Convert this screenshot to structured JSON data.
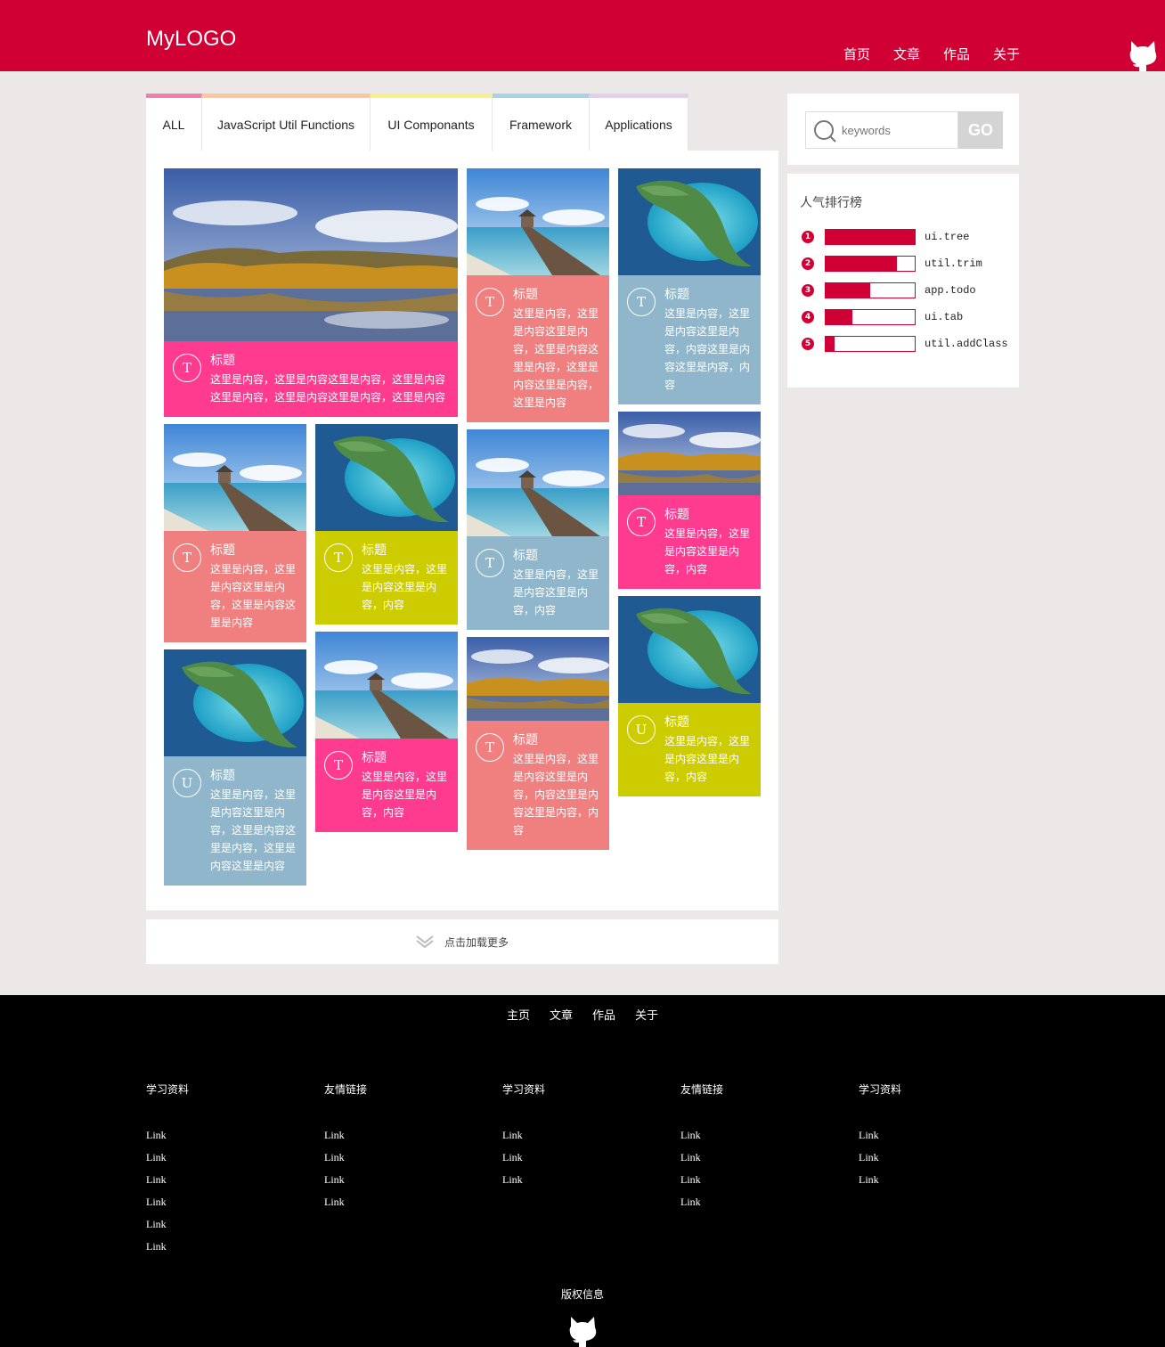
{
  "header": {
    "logo": "MyLOGO",
    "nav": [
      "首页",
      "文章",
      "作品",
      "关于"
    ]
  },
  "tabs": [
    {
      "label": "ALL",
      "color": "#f27fa9"
    },
    {
      "label": "JavaScript Util Functions",
      "color": "#f9c79b"
    },
    {
      "label": "UI Componants",
      "color": "#f7ef8a"
    },
    {
      "label": "Framework",
      "color": "#a7d3ea"
    },
    {
      "label": "Applications",
      "color": "#e4cfe8"
    }
  ],
  "cards": [
    {
      "badge": "T",
      "title": "标题",
      "text": "这里是内容，这里是内容这里是内容，这里是内容这里是内容，这里是内容这里是内容，这里是内容",
      "color": "#fe3b8f",
      "image": "lake"
    },
    {
      "badge": "T",
      "title": "标题",
      "text": "这里是内容，这里是内容这里是内容，这里是内容这里是内容，这里是内容这里是内容，这里是内容",
      "color": "#f08080",
      "image": "pier"
    },
    {
      "badge": "T",
      "title": "标题",
      "text": "这里是内容，这里是内容这里是内容，内容这里是内容这里是内容，内容",
      "color": "#8fb6cb",
      "image": "island"
    },
    {
      "badge": "T",
      "title": "标题",
      "text": "这里是内容，这里是内容这里是内容，这里是内容这里是内容",
      "color": "#f08080",
      "image": "pier"
    },
    {
      "badge": "T",
      "title": "标题",
      "text": "这里是内容，这里是内容这里是内容，内容",
      "color": "#cccc00",
      "image": "island"
    },
    {
      "badge": "T",
      "title": "标题",
      "text": "这里是内容，这里是内容这里是内容，内容",
      "color": "#8fb6cb",
      "image": "pier"
    },
    {
      "badge": "T",
      "title": "标题",
      "text": "这里是内容，这里是内容这里是内容，内容",
      "color": "#fe3b8f",
      "image": "lake"
    },
    {
      "badge": "U",
      "title": "标题",
      "text": "这里是内容，这里是内容这里是内容，这里是内容这里是内容，这里是内容这里是内容",
      "color": "#8fb6cb",
      "image": "island"
    },
    {
      "badge": "T",
      "title": "标题",
      "text": "这里是内容，这里是内容这里是内容，内容",
      "color": "#fe3b8f",
      "image": "pier"
    },
    {
      "badge": "T",
      "title": "标题",
      "text": "这里是内容，这里是内容这里是内容，内容这里是内容这里是内容，内容",
      "color": "#f08080",
      "image": "lake"
    },
    {
      "badge": "U",
      "title": "标题",
      "text": "这里是内容，这里是内容这里是内容，内容",
      "color": "#cccc00",
      "image": "island"
    }
  ],
  "load_more": "点击加载更多",
  "search": {
    "placeholder": "keywords",
    "button": "GO"
  },
  "ranking": {
    "title": "人气排行榜",
    "items": [
      {
        "rank": "1",
        "name": "ui.tree",
        "fill": 1.0
      },
      {
        "rank": "2",
        "name": "util.trim",
        "fill": 0.8
      },
      {
        "rank": "3",
        "name": "app.todo",
        "fill": 0.5
      },
      {
        "rank": "4",
        "name": "ui.tab",
        "fill": 0.3
      },
      {
        "rank": "5",
        "name": "util.addClass",
        "fill": 0.1
      }
    ]
  },
  "footer": {
    "nav": [
      "主页",
      "文章",
      "作品",
      "关于"
    ],
    "columns": [
      {
        "title": "学习资料",
        "links": [
          "Link",
          "Link",
          "Link",
          "Link",
          "Link",
          "Link"
        ]
      },
      {
        "title": "友情链接",
        "links": [
          "Link",
          "Link",
          "Link",
          "Link"
        ]
      },
      {
        "title": "学习资料",
        "links": [
          "Link",
          "Link",
          "Link"
        ]
      },
      {
        "title": "友情链接",
        "links": [
          "Link",
          "Link",
          "Link",
          "Link"
        ]
      },
      {
        "title": "学习资料",
        "links": [
          "Link",
          "Link",
          "Link"
        ]
      }
    ],
    "copyright": "版权信息"
  },
  "brand_color": "#d10034"
}
